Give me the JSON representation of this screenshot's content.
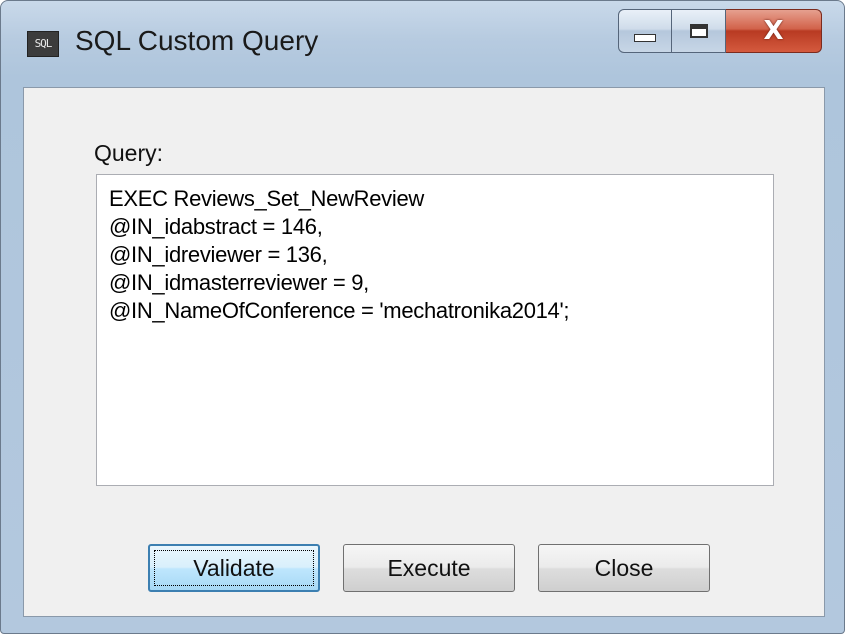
{
  "window": {
    "title": "SQL Custom Query",
    "app_icon_text": "SQL",
    "icon": "sql-app-icon"
  },
  "caption_buttons": {
    "minimize_icon": "minimize-icon",
    "maximize_icon": "maximize-icon",
    "close_glyph": "X",
    "close_icon": "close-icon"
  },
  "form": {
    "query_label": "Query:",
    "query_value": "EXEC Reviews_Set_NewReview\n@IN_idabstract = 146,\n@IN_idreviewer = 136,\n@IN_idmasterreviewer = 9,\n@IN_NameOfConference = 'mechatronika2014';"
  },
  "buttons": {
    "validate": "Validate",
    "execute": "Execute",
    "close": "Close"
  },
  "colors": {
    "close_button": "#c8462c",
    "default_button_border": "#3c7fb1",
    "client_background": "#f0f0f0"
  }
}
